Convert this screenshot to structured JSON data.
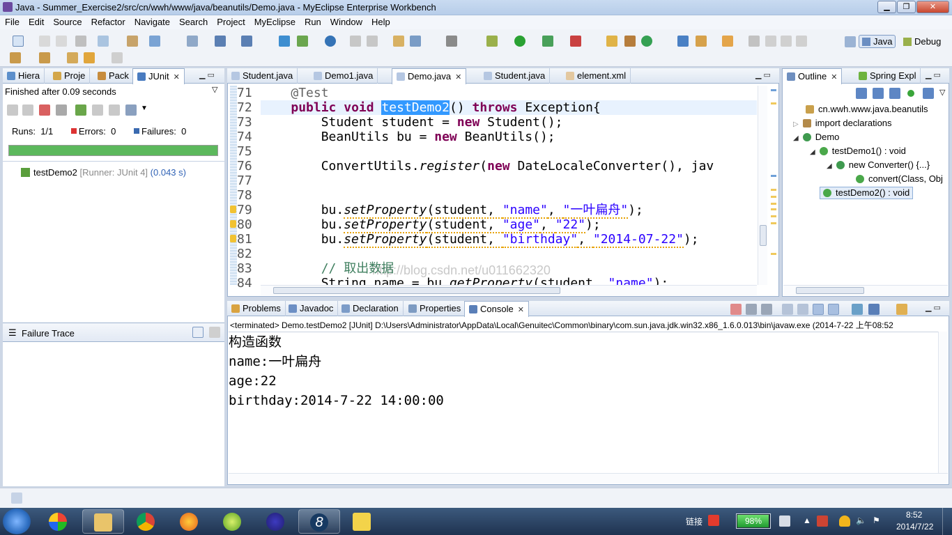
{
  "window": {
    "title": "Java - Summer_Exercise2/src/cn/wwh/www/java/beanutils/Demo.java - MyEclipse Enterprise Workbench"
  },
  "menu": [
    "File",
    "Edit",
    "Source",
    "Refactor",
    "Navigate",
    "Search",
    "Project",
    "MyEclipse",
    "Run",
    "Window",
    "Help"
  ],
  "perspectives": {
    "java": "Java",
    "debug": "Debug"
  },
  "left_tabs": [
    "Hiera",
    "Proje",
    "Pack",
    "JUnit"
  ],
  "junit": {
    "finished": "Finished after 0.09 seconds",
    "runs_label": "Runs:",
    "runs_value": "1/1",
    "errors_label": "Errors:",
    "errors_value": "0",
    "failures_label": "Failures:",
    "failures_value": "0",
    "progress": 1.0,
    "test_name": "testDemo2",
    "test_runner": "[Runner: JUnit 4]",
    "test_time": "(0.043 s)",
    "failure_trace": "Failure Trace"
  },
  "editor_tabs": [
    "Student.java",
    "Demo1.java",
    "Demo.java",
    "Student.java",
    "element.xml"
  ],
  "editor": {
    "lines": [
      {
        "n": "71",
        "segs": [
          {
            "t": "    "
          },
          {
            "t": "@Test",
            "c": "ann"
          }
        ]
      },
      {
        "n": "72",
        "segs": [
          {
            "t": "    "
          },
          {
            "t": "public",
            "c": "kw"
          },
          {
            "t": " "
          },
          {
            "t": "void",
            "c": "kw"
          },
          {
            "t": " "
          },
          {
            "t": "testDemo2",
            "c": "sel"
          },
          {
            "t": "() "
          },
          {
            "t": "throws",
            "c": "kw"
          },
          {
            "t": " Exception{"
          }
        ]
      },
      {
        "n": "73",
        "segs": [
          {
            "t": "        Student student = "
          },
          {
            "t": "new",
            "c": "kw"
          },
          {
            "t": " Student();"
          }
        ]
      },
      {
        "n": "74",
        "segs": [
          {
            "t": "        BeanUtils bu = "
          },
          {
            "t": "new",
            "c": "kw"
          },
          {
            "t": " BeanUtils();"
          }
        ]
      },
      {
        "n": "75",
        "segs": [
          {
            "t": ""
          }
        ]
      },
      {
        "n": "76",
        "segs": [
          {
            "t": "        ConvertUtils."
          },
          {
            "t": "register",
            "c": "it"
          },
          {
            "t": "("
          },
          {
            "t": "new",
            "c": "kw"
          },
          {
            "t": " DateLocaleConverter(), jav"
          }
        ]
      },
      {
        "n": "77",
        "segs": [
          {
            "t": ""
          }
        ]
      },
      {
        "n": "78",
        "segs": [
          {
            "t": ""
          }
        ]
      },
      {
        "n": "79",
        "segs": [
          {
            "t": "        bu."
          },
          {
            "t": "setProperty",
            "c": "it warnu"
          },
          {
            "t": "(student, ",
            "c": "warnu"
          },
          {
            "t": "\"name\"",
            "c": "str warnu"
          },
          {
            "t": ", ",
            "c": "warnu"
          },
          {
            "t": "\"一叶扁舟\"",
            "c": "str warnu"
          },
          {
            "t": ");"
          }
        ]
      },
      {
        "n": "80",
        "segs": [
          {
            "t": "        bu."
          },
          {
            "t": "setProperty",
            "c": "it warnu"
          },
          {
            "t": "(student, ",
            "c": "warnu"
          },
          {
            "t": "\"age\"",
            "c": "str warnu"
          },
          {
            "t": ", ",
            "c": "warnu"
          },
          {
            "t": "\"22\"",
            "c": "str warnu"
          },
          {
            "t": ");"
          }
        ]
      },
      {
        "n": "81",
        "segs": [
          {
            "t": "        bu."
          },
          {
            "t": "setProperty",
            "c": "it warnu"
          },
          {
            "t": "(student, ",
            "c": "warnu"
          },
          {
            "t": "\"birthday\"",
            "c": "str warnu"
          },
          {
            "t": ", ",
            "c": "warnu"
          },
          {
            "t": "\"2014-07-22\"",
            "c": "str warnu"
          },
          {
            "t": ");"
          }
        ]
      },
      {
        "n": "82",
        "segs": [
          {
            "t": ""
          }
        ]
      },
      {
        "n": "83",
        "segs": [
          {
            "t": "        "
          },
          {
            "t": "// 取出数据",
            "c": "cm"
          }
        ]
      },
      {
        "n": "84",
        "segs": [
          {
            "t": "        String name = bu."
          },
          {
            "t": "getProperty",
            "c": "it"
          },
          {
            "t": "(student, "
          },
          {
            "t": "\"name\"",
            "c": "str"
          },
          {
            "t": ");"
          }
        ]
      }
    ],
    "watermark": "http://blog.csdn.net/u011662320"
  },
  "outline_tabs": [
    "Outline",
    "Spring Expl"
  ],
  "outline": {
    "package": "cn.wwh.www.java.beanutils",
    "imports": "import declarations",
    "class": "Demo",
    "m1": "testDemo1() : void",
    "m1_child": "new Converter() {...}",
    "m1_grandchild": "convert(Class, Obj",
    "m2": "testDemo2() : void"
  },
  "bottom_tabs": [
    "Problems",
    "Javadoc",
    "Declaration",
    "Properties",
    "Console"
  ],
  "console": {
    "header": "<terminated> Demo.testDemo2 [JUnit] D:\\Users\\Administrator\\AppData\\Local\\Genuitec\\Common\\binary\\com.sun.java.jdk.win32.x86_1.6.0.013\\bin\\javaw.exe (2014-7-22 上午08:52",
    "lines": [
      "构造函数",
      "name:一叶扁舟",
      "age:22",
      "birthday:2014-7-22 14:00:00"
    ]
  },
  "taskbar": {
    "battery": "98%",
    "ime": "链接",
    "time": "8:52",
    "date": "2014/7/22"
  }
}
